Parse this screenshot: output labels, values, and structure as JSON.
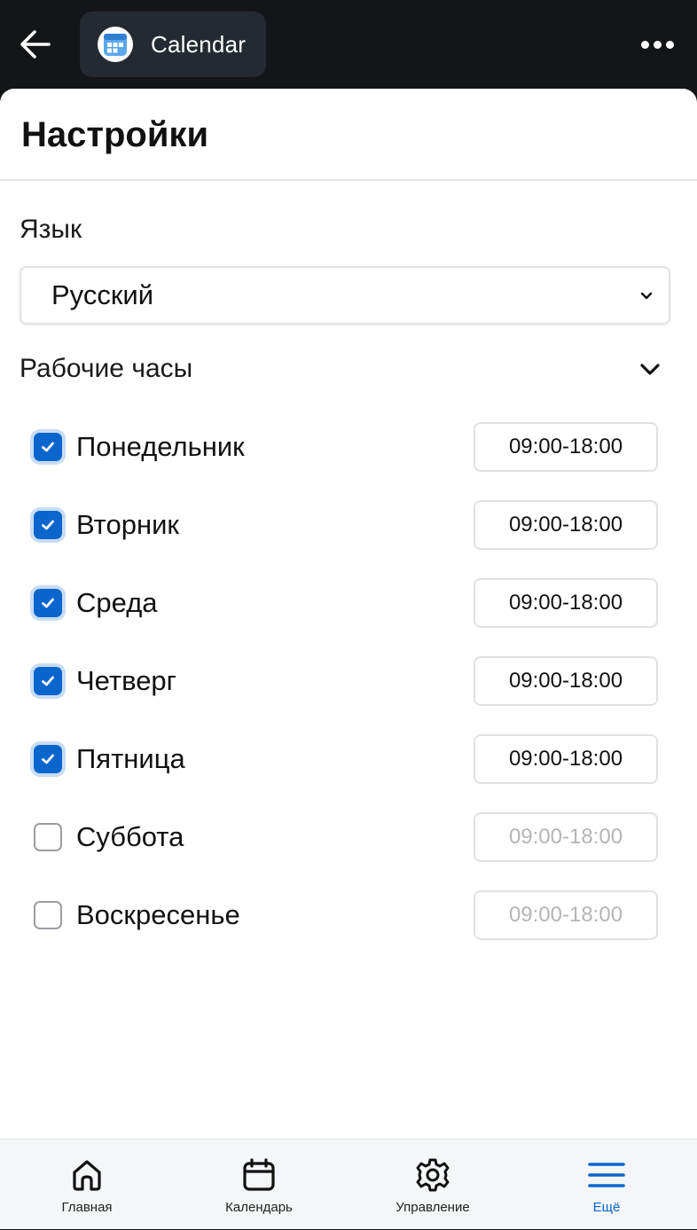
{
  "topbar": {
    "app_title": "Calendar",
    "back_icon": "arrow-left-icon",
    "app_icon": "calendar-app-icon",
    "more_icon": "more-horizontal-icon"
  },
  "settings": {
    "title": "Настройки",
    "language_label": "Язык",
    "language_value": "Русский",
    "working_hours_label": "Рабочие часы",
    "days": [
      {
        "name": "Понедельник",
        "enabled": true,
        "hours": "09:00-18:00"
      },
      {
        "name": "Вторник",
        "enabled": true,
        "hours": "09:00-18:00"
      },
      {
        "name": "Среда",
        "enabled": true,
        "hours": "09:00-18:00"
      },
      {
        "name": "Четверг",
        "enabled": true,
        "hours": "09:00-18:00"
      },
      {
        "name": "Пятница",
        "enabled": true,
        "hours": "09:00-18:00"
      },
      {
        "name": "Суббота",
        "enabled": false,
        "hours": "09:00-18:00"
      },
      {
        "name": "Воскресенье",
        "enabled": false,
        "hours": "09:00-18:00"
      }
    ]
  },
  "bottom_nav": {
    "items": [
      {
        "label": "Главная",
        "icon": "home-icon"
      },
      {
        "label": "Календарь",
        "icon": "calendar-icon"
      },
      {
        "label": "Управление",
        "icon": "gear-icon"
      },
      {
        "label": "Ещё",
        "icon": "menu-icon",
        "active": true
      }
    ]
  },
  "colors": {
    "accent": "#0a66cc",
    "topbar_bg": "#141518",
    "chip_bg": "#252a32"
  }
}
